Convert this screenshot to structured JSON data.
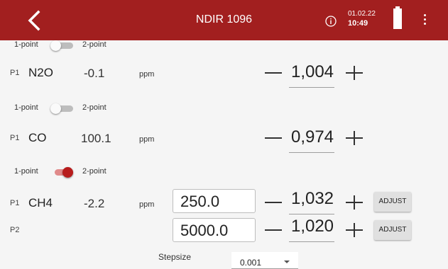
{
  "header": {
    "title": "NDIR 1096",
    "date": "01.02.22",
    "time": "10:49",
    "bg_color": "#a21f1f",
    "back_icon": "chevron-left-icon",
    "info_icon": "info-icon",
    "battery_icon": "battery-full-icon",
    "menu_icon": "more-vert-icon"
  },
  "mode_labels": {
    "one": "1-point",
    "two": "2-point"
  },
  "gases": [
    {
      "point": "P1",
      "name": "N2O",
      "value": "-0.1",
      "unit": "ppm",
      "factor": "1,004",
      "two_point": false
    },
    {
      "point": "P1",
      "name": "CO",
      "value": "100.1",
      "unit": "ppm",
      "factor": "0,974",
      "two_point": false
    },
    {
      "point": "P1",
      "name": "CH4",
      "value": "-2.2",
      "unit": "ppm",
      "factor": "1,032",
      "two_point": true,
      "setpoint": "250.0",
      "adjust_label": "ADJUST"
    }
  ],
  "p2": {
    "point": "P2",
    "setpoint": "5000.0",
    "factor": "1,020",
    "adjust_label": "ADJUST"
  },
  "stepsize": {
    "label": "Stepsize",
    "value": "0.001"
  },
  "colors": {
    "toggle_on": "#b71c1c",
    "toggle_track_on": "#e08a8a",
    "toggle_off": "#bdbdbd"
  }
}
